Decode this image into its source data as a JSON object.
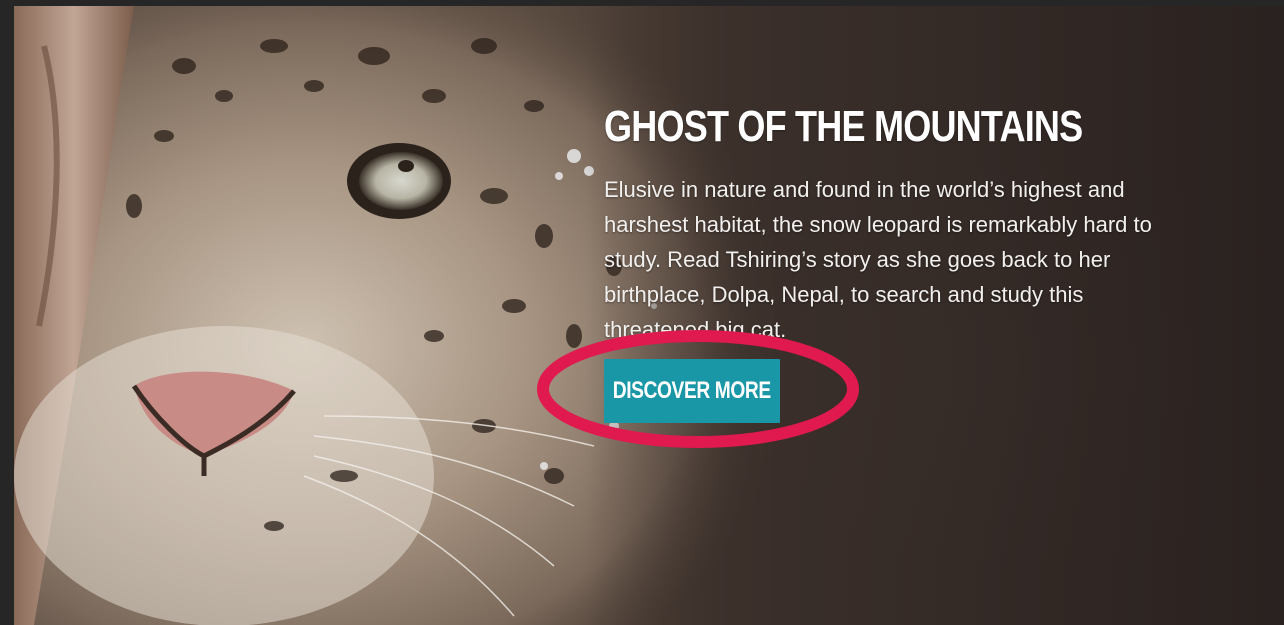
{
  "hero": {
    "image": "snow-leopard-close-up-photo",
    "headline": "GHOST OF THE MOUNTAINS",
    "body_lines": [
      "Elusive in nature and found in the world’s highest and",
      "harshest habitat, the snow leopard is remarkably hard to",
      "study. Read Tshiring’s story as she goes back to her",
      "birthplace, Dolpa, Nepal, to search and study this",
      "threatened big cat."
    ],
    "cta_label": "DISCOVER MORE"
  },
  "colors": {
    "button": "#1a97a6",
    "highlight": "#e0194f",
    "text": "#ffffff"
  }
}
